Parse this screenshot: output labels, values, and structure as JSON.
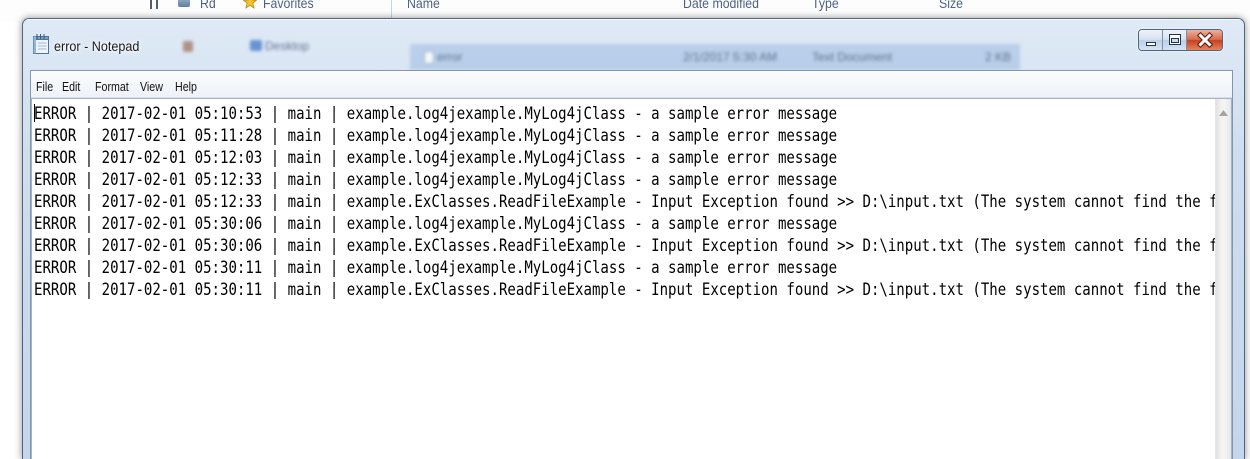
{
  "background_explorer": {
    "nav_label_partial": "Rd",
    "favorites_label": "Favorites",
    "columns": {
      "name": "Name",
      "date_modified": "Date modified",
      "type": "Type",
      "size": "Size"
    },
    "nav_item_desktop": "Desktop",
    "selected_file": {
      "name": "error",
      "date_modified": "2/1/2017 5:30 AM",
      "type": "Text Document",
      "size": "2 KB"
    },
    "icons": {
      "favorites": "star-icon",
      "desktop": "desktop-folder-icon",
      "file": "text-document-icon"
    }
  },
  "window": {
    "title": "error - Notepad",
    "app_icon": "notepad-icon",
    "caption_buttons": [
      {
        "name": "minimize",
        "icon": "minimize-icon"
      },
      {
        "name": "maximize",
        "icon": "maximize-icon"
      },
      {
        "name": "close",
        "icon": "close-icon"
      }
    ]
  },
  "menu": {
    "items": [
      {
        "label": "File"
      },
      {
        "label": "Edit"
      },
      {
        "label": "Format"
      },
      {
        "label": "View"
      },
      {
        "label": "Help"
      }
    ]
  },
  "editor": {
    "lines": [
      "ERROR | 2017-02-01 05:10:53 | main | example.log4jexample.MyLog4jClass - a sample error message",
      "ERROR | 2017-02-01 05:11:28 | main | example.log4jexample.MyLog4jClass - a sample error message",
      "ERROR | 2017-02-01 05:12:03 | main | example.log4jexample.MyLog4jClass - a sample error message",
      "ERROR | 2017-02-01 05:12:33 | main | example.log4jexample.MyLog4jClass - a sample error message",
      "ERROR | 2017-02-01 05:12:33 | main | example.ExClasses.ReadFileExample - Input Exception found >> D:\\input.txt (The system cannot find the f",
      "ERROR | 2017-02-01 05:30:06 | main | example.log4jexample.MyLog4jClass - a sample error message",
      "ERROR | 2017-02-01 05:30:06 | main | example.ExClasses.ReadFileExample - Input Exception found >> D:\\input.txt (The system cannot find the f",
      "ERROR | 2017-02-01 05:30:11 | main | example.log4jexample.MyLog4jClass - a sample error message",
      "ERROR | 2017-02-01 05:30:11 | main | example.ExClasses.ReadFileExample - Input Exception found >> D:\\input.txt (The system cannot find the f"
    ],
    "scrollbar": {
      "orientation": "vertical",
      "up_icon": "scroll-up-arrow-icon"
    }
  },
  "colors": {
    "frame_glass": "#c8d9ed",
    "close_button": "#c9452a",
    "editor_background": "#ffffff",
    "editor_text": "#000000",
    "menu_background": "#f2f5f9"
  }
}
